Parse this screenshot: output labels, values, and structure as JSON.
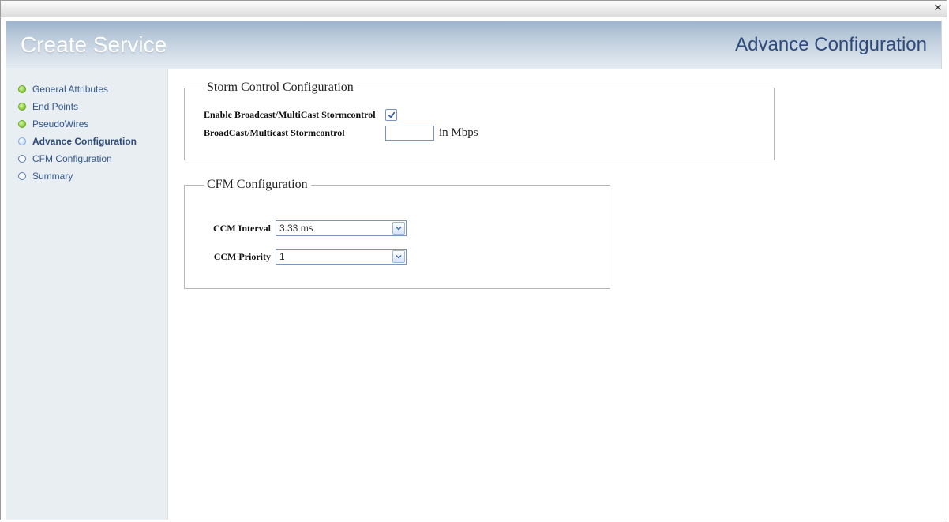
{
  "header": {
    "title_left": "Create Service",
    "title_right": "Advance Configuration"
  },
  "sidebar": {
    "steps": [
      {
        "label": "General Attributes",
        "state": "done"
      },
      {
        "label": "End Points",
        "state": "done"
      },
      {
        "label": "PseudoWires",
        "state": "done"
      },
      {
        "label": "Advance Configuration",
        "state": "current"
      },
      {
        "label": "CFM Configuration",
        "state": "todo"
      },
      {
        "label": "Summary",
        "state": "todo"
      }
    ]
  },
  "storm": {
    "legend": "Storm Control Configuration",
    "enable_label": "Enable Broadcast/MultiCast Stormcontrol",
    "enable_checked": true,
    "rate_label": "BroadCast/Multicast Stormcontrol",
    "rate_value": "",
    "rate_unit": "in Mbps"
  },
  "cfm": {
    "legend": "CFM Configuration",
    "interval_label": "CCM Interval",
    "interval_value": "3.33 ms",
    "priority_label": "CCM Priority",
    "priority_value": "1"
  }
}
